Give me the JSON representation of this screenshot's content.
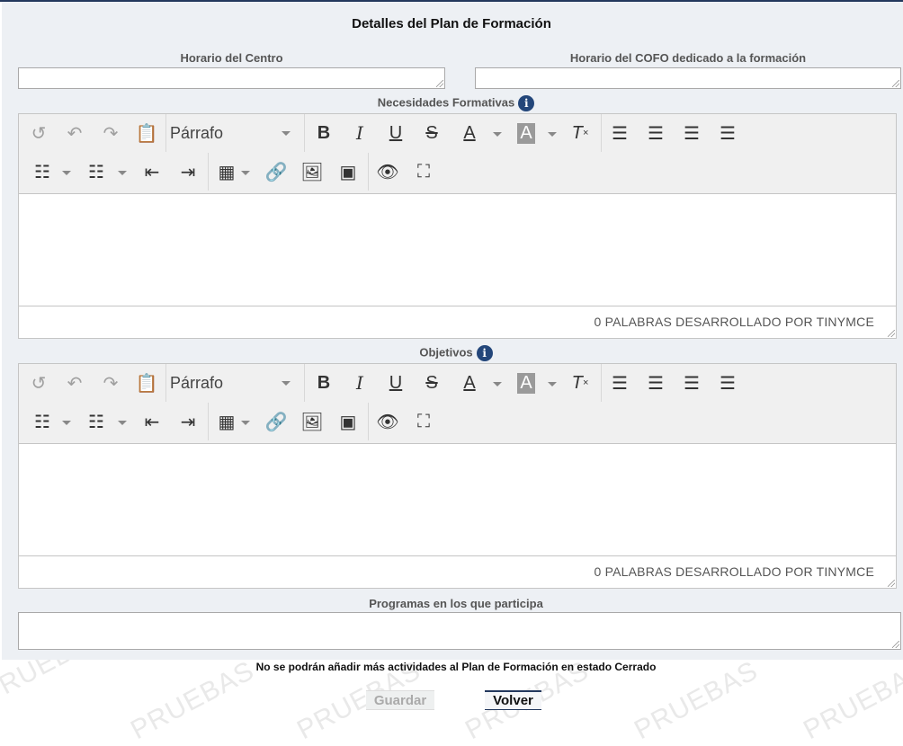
{
  "page": {
    "title": "Detalles del Plan de Formación",
    "watermark_text": "PRUEBAS"
  },
  "fields": {
    "horario_centro": {
      "label": "Horario del Centro",
      "value": ""
    },
    "horario_cofo": {
      "label": "Horario del COFO dedicado a la formación",
      "value": ""
    },
    "programas": {
      "label": "Programas en los que participa",
      "value": ""
    }
  },
  "editors": [
    {
      "label": "Necesidades Formativas",
      "info_glyph": "i",
      "format_value": "Párrafo",
      "status": "0 PALABRAS DESARROLLADO POR TINYMCE",
      "content": ""
    },
    {
      "label": "Objetivos",
      "info_glyph": "i",
      "format_value": "Párrafo",
      "status": "0 PALABRAS DESARROLLADO POR TINYMCE",
      "content": ""
    }
  ],
  "toolbar_icons": [
    "history-icon",
    "undo-icon",
    "redo-icon",
    "paste-icon",
    "bold-icon",
    "italic-icon",
    "underline-icon",
    "strikethrough-icon",
    "text-color-icon",
    "background-color-icon",
    "clear-format-icon",
    "align-left-icon",
    "align-center-icon",
    "align-right-icon",
    "justify-icon",
    "bullet-list-icon",
    "numbered-list-icon",
    "outdent-icon",
    "indent-icon",
    "table-icon",
    "link-icon",
    "image-icon",
    "media-icon",
    "preview-icon",
    "fullscreen-icon"
  ],
  "notice": "No se podrán añadir más actividades al Plan de Formación en estado Cerrado",
  "buttons": {
    "guardar": "Guardar",
    "volver": "Volver"
  },
  "colors": {
    "accent": "#23385d",
    "info_icon": "#23467a",
    "panel_bg": "#edf0f4"
  }
}
